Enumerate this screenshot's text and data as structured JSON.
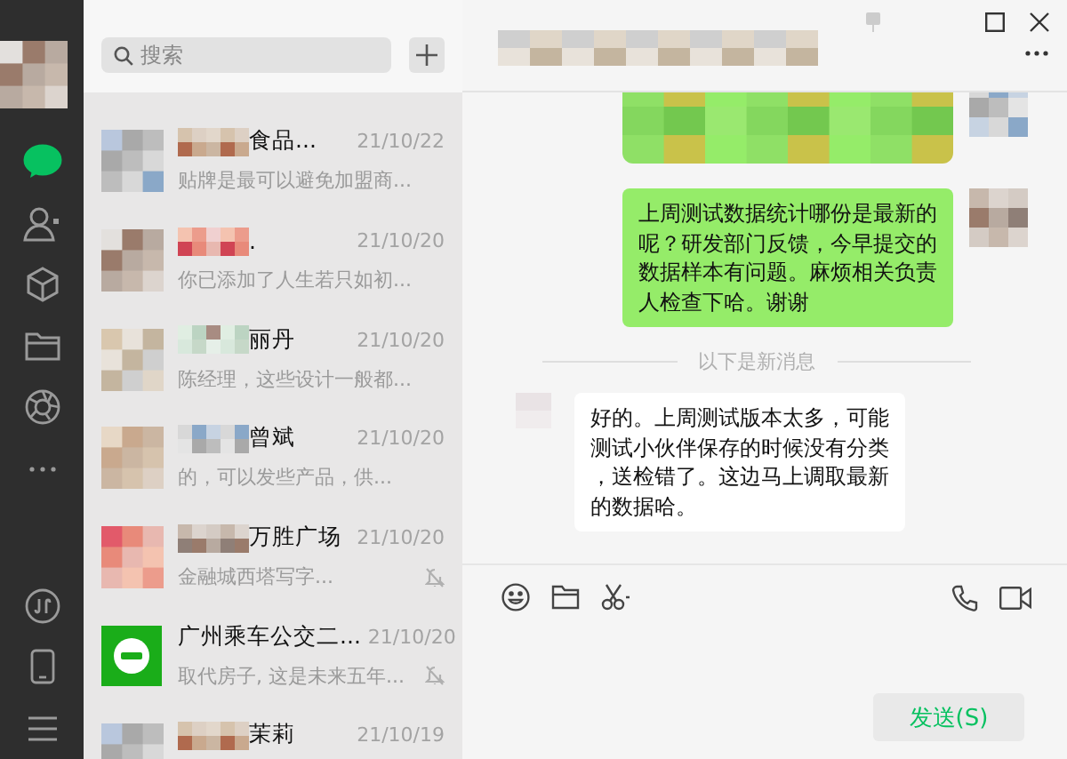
{
  "sidebar": {
    "items": [
      {
        "kind": "avatar"
      },
      {
        "kind": "chat",
        "selected": true
      },
      {
        "kind": "contacts",
        "selected": false
      },
      {
        "kind": "cube",
        "selected": false
      },
      {
        "kind": "folder",
        "selected": false
      },
      {
        "kind": "aperture",
        "selected": false
      },
      {
        "kind": "more",
        "selected": false
      },
      {
        "kind": "link",
        "selected": false
      },
      {
        "kind": "phone",
        "selected": false
      },
      {
        "kind": "menu",
        "selected": false
      }
    ]
  },
  "search": {
    "placeholder": "搜索"
  },
  "chats": [
    {
      "blurred": true,
      "name": "食品...",
      "time": "21/10/22",
      "preview": "贴牌是最可以避免加盟商...",
      "muted": false
    },
    {
      "blurred": true,
      "name": ".",
      "time": "21/10/20",
      "preview": "你已添加了人生若只如初...",
      "muted": false
    },
    {
      "blurred": true,
      "name": "丽丹",
      "time": "21/10/20",
      "preview": "陈经理，这些设计一般都...",
      "muted": false
    },
    {
      "blurred": true,
      "name": "曾斌",
      "time": "21/10/20",
      "preview": "的，可以发些产品，供...",
      "muted": false
    },
    {
      "blurred": true,
      "name": "万胜广场",
      "time": "21/10/20",
      "preview": "金融城西塔写字...",
      "muted": true
    },
    {
      "avatar": {
        "kind": "logo"
      },
      "blurred": false,
      "name": "广州乘车公交二...",
      "time": "21/10/20",
      "preview": "取代房子, 这是未来五年...",
      "muted": true
    },
    {
      "blurred": true,
      "name": "茉莉",
      "time": "21/10/19",
      "muted": false
    }
  ],
  "chat": {
    "messages": [
      {
        "kind": "outgoing",
        "blurred": true
      },
      {
        "kind": "outgoing",
        "blurred": false,
        "text": "上周测试数据统计哪份是最新的呢？研发部门反馈，今早提交的数据样本有问题。麻烦相关负责人检查下哈。谢谢"
      },
      {
        "kind": "divider",
        "text": "以下是新消息"
      },
      {
        "kind": "incoming",
        "blurred": false,
        "text": "好的。上周测试版本太多，可能测试小伙伴保存的时候没有分类，送检错了。这边马上调取最新的数据哈。"
      }
    ],
    "send_button": "发送(S)"
  }
}
